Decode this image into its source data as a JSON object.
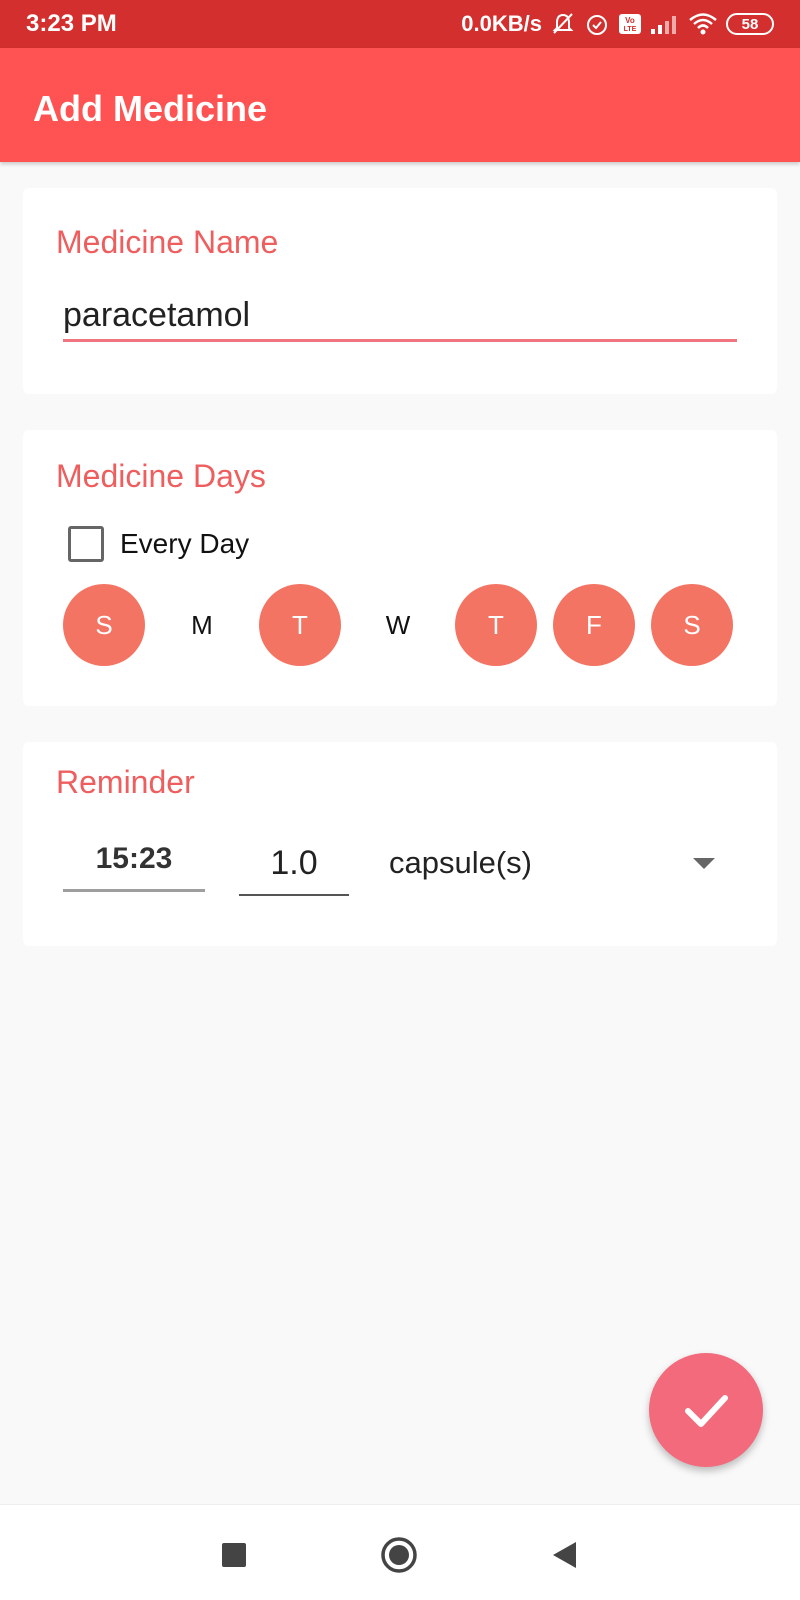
{
  "status_bar": {
    "time": "3:23 PM",
    "network_speed": "0.0KB/s",
    "battery": "58",
    "icons": [
      "mute-bell-icon",
      "alarm-icon",
      "volte-icon",
      "signal-icon",
      "wifi-icon",
      "battery-icon"
    ]
  },
  "app_bar": {
    "title": "Add Medicine",
    "color": "#ff5252"
  },
  "medicine_name": {
    "label": "Medicine Name",
    "value": "paracetamol"
  },
  "medicine_days": {
    "label": "Medicine Days",
    "every_day_label": "Every Day",
    "every_day_checked": false,
    "days": [
      {
        "label": "S",
        "selected": true
      },
      {
        "label": "M",
        "selected": false
      },
      {
        "label": "T",
        "selected": true
      },
      {
        "label": "W",
        "selected": false
      },
      {
        "label": "T",
        "selected": true
      },
      {
        "label": "F",
        "selected": true
      },
      {
        "label": "S",
        "selected": true
      }
    ]
  },
  "reminder": {
    "label": "Reminder",
    "time": "15:23",
    "dose": "1.0",
    "unit": "capsule(s)"
  },
  "fab": {
    "icon": "check-icon"
  },
  "nav_bar": {
    "icons": [
      "recents-square-icon",
      "home-circle-icon",
      "back-triangle-icon"
    ]
  },
  "colors": {
    "accent": "#ef5e5e",
    "day_selected": "#f47464",
    "fab": "#f26a7b",
    "status_bar": "#d32f2f"
  }
}
